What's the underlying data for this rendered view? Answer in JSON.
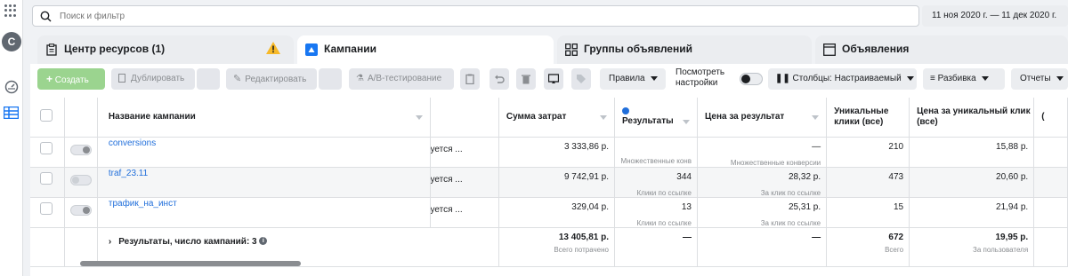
{
  "search": {
    "placeholder": "Поиск и фильтр"
  },
  "date_range": "11 ноя 2020 г. — 11 дек 2020 г.",
  "avatar_letter": "C",
  "tabs": [
    {
      "label": "Центр ресурсов (1)"
    },
    {
      "label": "Кампании"
    },
    {
      "label": "Группы объявлений"
    },
    {
      "label": "Объявления"
    }
  ],
  "toolbar": {
    "create": "Создать",
    "duplicate": "Дублировать",
    "edit": "Редактировать",
    "ab_test": "A/B-тестирование",
    "rules": "Правила",
    "view_settings": "Посмотреть настройки",
    "columns": "Столбцы: Настраиваемый",
    "breakdown": "Разбивка",
    "reports": "Отчеты"
  },
  "table": {
    "headers": {
      "name": "Название кампании",
      "spend": "Сумма затрат",
      "results": "Результаты",
      "cost_per_result": "Цена за результат",
      "unique_clicks": "Уникальные клики (все)",
      "cost_per_unique": "Цена за уникальный клик (все)",
      "partial": "("
    },
    "rows": [
      {
        "name": "conversions",
        "delivery": "уется ...",
        "spend": "3 333,86 р.",
        "results": "",
        "results_sub": "Множественные конв",
        "cpr": "—",
        "cpr_sub": "Множественные конверсии",
        "unique": "210",
        "cpu": "15,88 р.",
        "toggle": "on"
      },
      {
        "name": "traf_23.11",
        "delivery": "уется ...",
        "spend": "9 742,91 р.",
        "results": "344",
        "results_sub": "Клики по ссылке",
        "cpr": "28,32 р.",
        "cpr_sub": "За клик по ссылке",
        "unique": "473",
        "cpu": "20,60 р.",
        "toggle": "off"
      },
      {
        "name": "трафик_на_инст",
        "delivery": "уется ...",
        "spend": "329,04 р.",
        "results": "13",
        "results_sub": "Клики по ссылке",
        "cpr": "25,31 р.",
        "cpr_sub": "За клик по ссылке",
        "unique": "15",
        "cpu": "21,94 р.",
        "toggle": "on"
      }
    ],
    "summary": {
      "label": "Результаты, число кампаний: 3",
      "spend": "13 405,81 р.",
      "spend_sub": "Всего потрачено",
      "results": "—",
      "cpr": "—",
      "unique": "672",
      "unique_sub": "Всего",
      "cpu": "19,95 р.",
      "cpu_sub": "За пользователя"
    }
  },
  "colors": {
    "accent": "#216fdb",
    "create_green": "#9bd48f",
    "warning": "#f7b928"
  }
}
